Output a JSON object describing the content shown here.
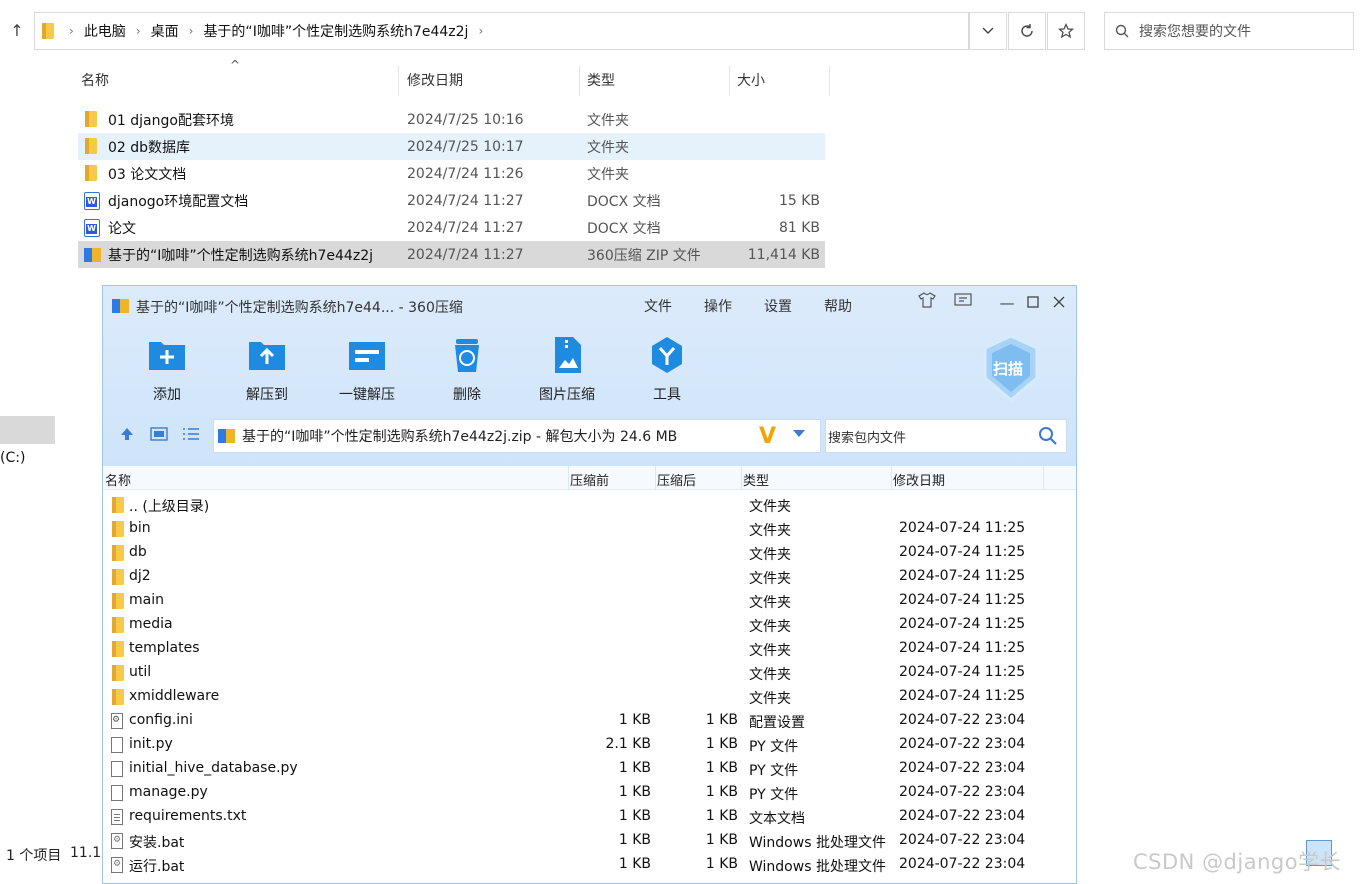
{
  "explorer": {
    "breadcrumbs": [
      "此电脑",
      "桌面",
      "基于的“I咖啡”个性定制选购系统h7e44z2j"
    ],
    "search_placeholder": "搜索您想要的文件",
    "columns": {
      "name": "名称",
      "date": "修改日期",
      "type": "类型",
      "size": "大小"
    },
    "files": [
      {
        "icon": "folder-icon",
        "name": "01 django配套环境",
        "date": "2024/7/25 10:16",
        "type": "文件夹",
        "size": ""
      },
      {
        "icon": "folder-icon",
        "name": "02 db数据库",
        "date": "2024/7/25 10:17",
        "type": "文件夹",
        "size": ""
      },
      {
        "icon": "folder-icon",
        "name": "03 论文文档",
        "date": "2024/7/24 11:26",
        "type": "文件夹",
        "size": ""
      },
      {
        "icon": "word-doc-icon",
        "name": "djanogo环境配置文档",
        "date": "2024/7/24 11:27",
        "type": "DOCX 文档",
        "size": "15 KB"
      },
      {
        "icon": "word-doc-icon",
        "name": "论文",
        "date": "2024/7/24 11:27",
        "type": "DOCX 文档",
        "size": "81 KB"
      },
      {
        "icon": "zip-icon",
        "name": "基于的“I咖啡”个性定制选购系统h7e44z2j",
        "date": "2024/7/24 11:27",
        "type": "360压缩 ZIP 文件",
        "size": "11,414 KB"
      }
    ],
    "left_drive_label": "(C:)",
    "status_items": "1 个项目",
    "status_size": "11.1"
  },
  "zip": {
    "title": "基于的“I咖啡”个性定制选购系统h7e44... - 360压缩",
    "menu": [
      "文件",
      "操作",
      "设置",
      "帮助"
    ],
    "tools": [
      {
        "icon": "add-icon",
        "label": "添加"
      },
      {
        "icon": "extract-to-icon",
        "label": "解压到"
      },
      {
        "icon": "one-click-extract-icon",
        "label": "一键解压"
      },
      {
        "icon": "delete-icon",
        "label": "删除"
      },
      {
        "icon": "image-compress-icon",
        "label": "图片压缩"
      },
      {
        "icon": "tools-icon",
        "label": "工具"
      }
    ],
    "scan_label": "扫描",
    "path": "基于的“I咖啡”个性定制选购系统h7e44z2j.zip - 解包大小为 24.6 MB",
    "search_placeholder": "搜索包内文件",
    "columns": {
      "name": "名称",
      "before": "压缩前",
      "after": "压缩后",
      "type": "类型",
      "date": "修改日期"
    },
    "rows": [
      {
        "icon": "folder-icon",
        "name": ".. (上级目录)",
        "before": "",
        "after": "",
        "type": "文件夹",
        "date": ""
      },
      {
        "icon": "folder-icon",
        "name": "bin",
        "before": "",
        "after": "",
        "type": "文件夹",
        "date": "2024-07-24 11:25"
      },
      {
        "icon": "folder-icon",
        "name": "db",
        "before": "",
        "after": "",
        "type": "文件夹",
        "date": "2024-07-24 11:25"
      },
      {
        "icon": "folder-icon",
        "name": "dj2",
        "before": "",
        "after": "",
        "type": "文件夹",
        "date": "2024-07-24 11:25"
      },
      {
        "icon": "folder-icon",
        "name": "main",
        "before": "",
        "after": "",
        "type": "文件夹",
        "date": "2024-07-24 11:25"
      },
      {
        "icon": "folder-icon",
        "name": "media",
        "before": "",
        "after": "",
        "type": "文件夹",
        "date": "2024-07-24 11:25"
      },
      {
        "icon": "folder-icon",
        "name": "templates",
        "before": "",
        "after": "",
        "type": "文件夹",
        "date": "2024-07-24 11:25"
      },
      {
        "icon": "folder-icon",
        "name": "util",
        "before": "",
        "after": "",
        "type": "文件夹",
        "date": "2024-07-24 11:25"
      },
      {
        "icon": "folder-icon",
        "name": "xmiddleware",
        "before": "",
        "after": "",
        "type": "文件夹",
        "date": "2024-07-24 11:25"
      },
      {
        "icon": "config-file-icon",
        "name": "config.ini",
        "before": "1 KB",
        "after": "1 KB",
        "type": "配置设置",
        "date": "2024-07-22 23:04"
      },
      {
        "icon": "file-icon",
        "name": "init.py",
        "before": "2.1 KB",
        "after": "1 KB",
        "type": "PY 文件",
        "date": "2024-07-22 23:04"
      },
      {
        "icon": "file-icon",
        "name": "initial_hive_database.py",
        "before": "1 KB",
        "after": "1 KB",
        "type": "PY 文件",
        "date": "2024-07-22 23:04"
      },
      {
        "icon": "file-icon",
        "name": "manage.py",
        "before": "1 KB",
        "after": "1 KB",
        "type": "PY 文件",
        "date": "2024-07-22 23:04"
      },
      {
        "icon": "text-file-icon",
        "name": "requirements.txt",
        "before": "1 KB",
        "after": "1 KB",
        "type": "文本文档",
        "date": "2024-07-22 23:04"
      },
      {
        "icon": "batch-file-icon",
        "name": "安装.bat",
        "before": "1 KB",
        "after": "1 KB",
        "type": "Windows 批处理文件",
        "date": "2024-07-22 23:04"
      },
      {
        "icon": "batch-file-icon",
        "name": "运行.bat",
        "before": "1 KB",
        "after": "1 KB",
        "type": "Windows 批处理文件",
        "date": "2024-07-22 23:04"
      }
    ]
  },
  "watermark": "CSDN @django学长"
}
